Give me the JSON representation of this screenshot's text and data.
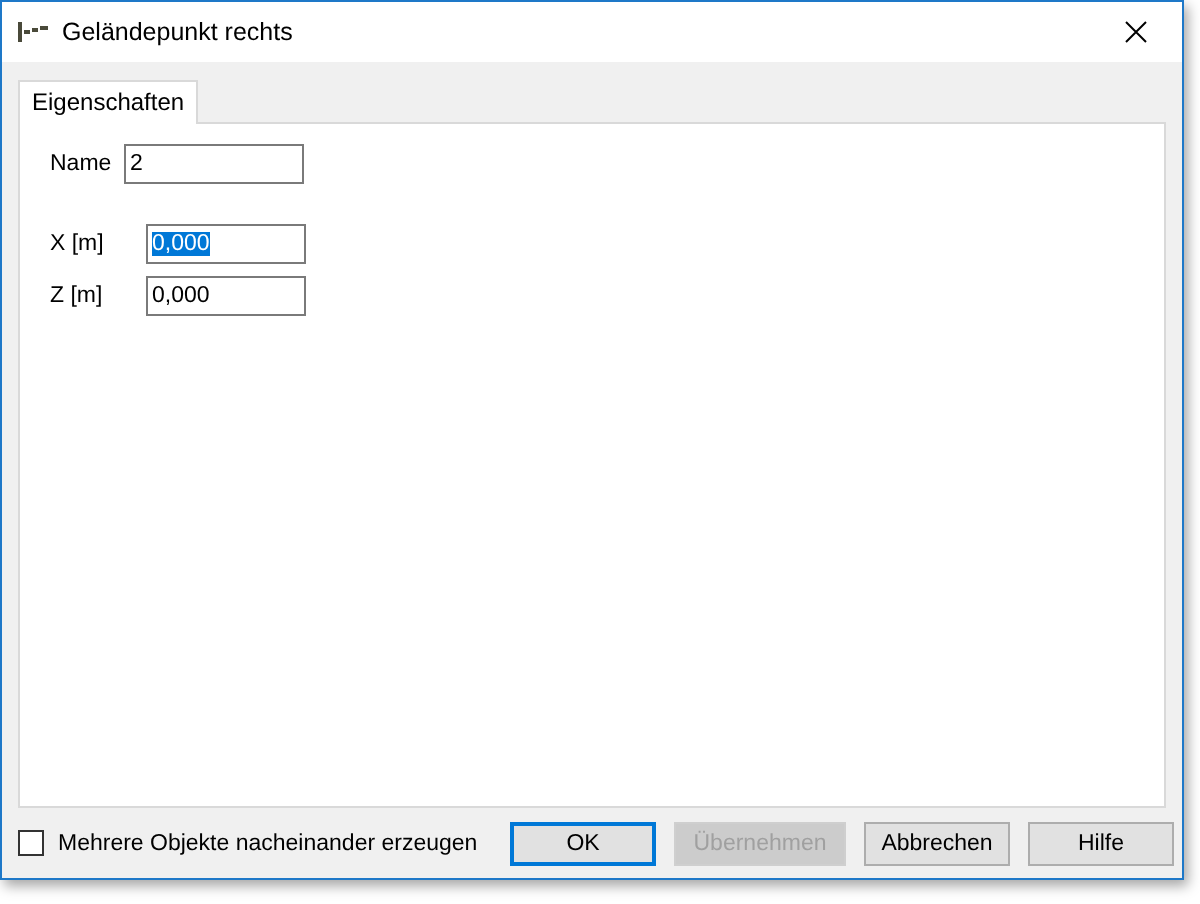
{
  "window": {
    "title": "Geländepunkt rechts"
  },
  "tabs": [
    {
      "label": "Eigenschaften",
      "selected": true
    }
  ],
  "name_field": {
    "label": "Name",
    "value": "2",
    "selected": false
  },
  "coordinate_fields": [
    {
      "label": "X [m]",
      "value": "0,000",
      "selected": true
    },
    {
      "label": "Z [m]",
      "value": "0,000",
      "selected": false
    }
  ],
  "footer": {
    "checkbox": {
      "label": "Mehrere Objekte nacheinander erzeugen",
      "checked": false
    },
    "buttons": [
      {
        "label": "OK",
        "default": true,
        "disabled": false
      },
      {
        "label": "Übernehmen",
        "default": false,
        "disabled": true
      },
      {
        "label": "Abbrechen",
        "default": false,
        "disabled": false
      },
      {
        "label": "Hilfe",
        "default": false,
        "disabled": false
      }
    ]
  }
}
